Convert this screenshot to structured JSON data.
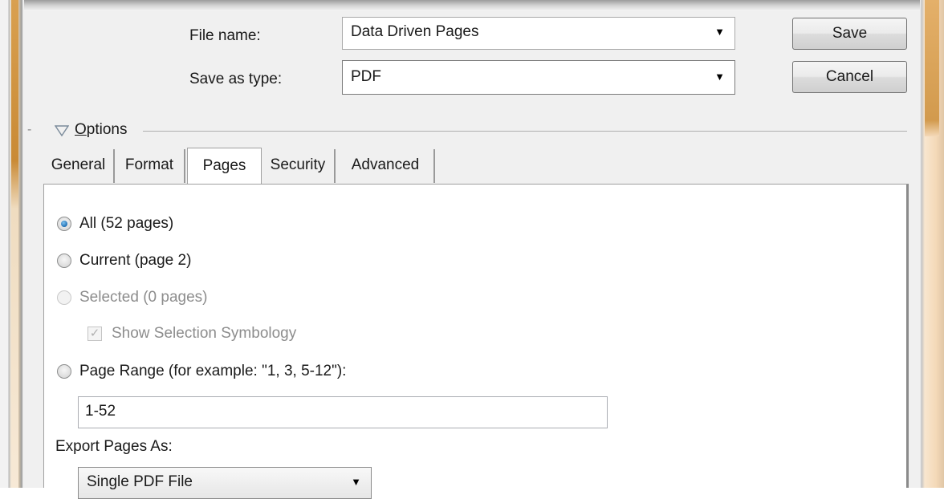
{
  "file_name": {
    "label": "File name:",
    "value": "Data Driven Pages"
  },
  "save_as_type": {
    "label": "Save as type:",
    "value": "PDF"
  },
  "buttons": {
    "save": "Save",
    "cancel": "Cancel"
  },
  "options": {
    "prefix": "-",
    "title_underline": "O",
    "title_rest": "ptions"
  },
  "tabs": [
    {
      "label": "General",
      "active": false
    },
    {
      "label": "Format",
      "active": false
    },
    {
      "label": "Pages",
      "active": true
    },
    {
      "label": "Security",
      "active": false
    },
    {
      "label": "Advanced",
      "active": false
    }
  ],
  "pages": {
    "all": {
      "label": "All (52 pages)",
      "checked": true
    },
    "current": {
      "label": "Current (page 2)",
      "checked": false
    },
    "selected": {
      "label": "Selected (0 pages)",
      "checked": false,
      "enabled": false
    },
    "show_selection": {
      "label": "Show Selection Symbology",
      "checked": true,
      "enabled": false
    },
    "page_range": {
      "label": "Page Range (for example: \"1, 3, 5-12\"):",
      "checked": false
    },
    "range_value": "1-52",
    "export_label": "Export Pages As:",
    "export_value": "Single PDF File"
  },
  "icons": {
    "dropdown": "chevron-down-icon",
    "collapse": "triangle-down-icon",
    "check": "checkmark-icon"
  },
  "colors": {
    "dialog_bg": "#f0f0f0",
    "radio_accent": "#1f6fb4",
    "disabled_text": "#8d8d8d"
  }
}
